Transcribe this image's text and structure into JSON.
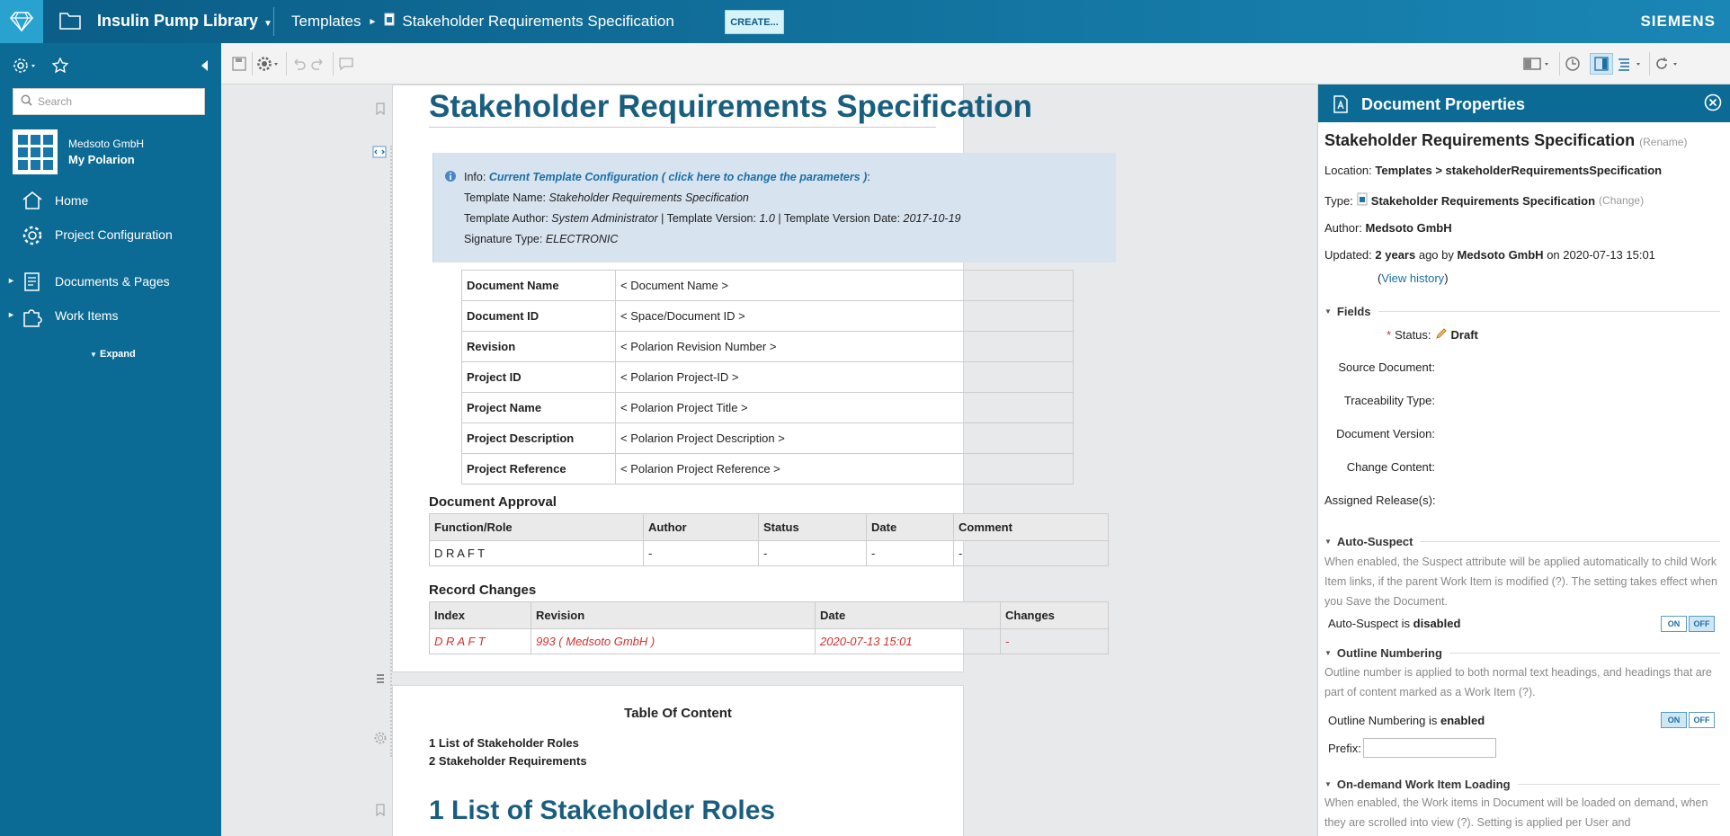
{
  "topbar": {
    "project": "Insulin Pump Library",
    "crumb_parent": "Templates",
    "crumb_doc": "Stakeholder Requirements Specification",
    "create_label": "CREATE...",
    "brand": "SIEMENS"
  },
  "sidebar": {
    "search_placeholder": "Search",
    "org": "Medsoto GmbH",
    "proj": "My Polarion",
    "home": "Home",
    "project_configuration": "Project Configuration",
    "documents_pages": "Documents & Pages",
    "work_items": "Work Items",
    "expand": "Expand"
  },
  "document": {
    "title": "Stakeholder Requirements Specification",
    "info": {
      "prefix": "Info:",
      "link": "Current Template Configuration ( click here to change the parameters )",
      "suffix": ":",
      "name_label": "Template Name:",
      "name_value": "Stakeholder Requirements Specification",
      "author_label": "Template Author:",
      "author_value": "System Administrator",
      "version_label": "| Template Version:",
      "version_value": "1.0",
      "date_label": "| Template Version Date:",
      "date_value": "2017-10-19",
      "sig_label": "Signature Type:",
      "sig_value": "ELECTRONIC"
    },
    "meta": [
      {
        "k": "Document Name",
        "v": "< Document Name >"
      },
      {
        "k": "Document ID",
        "v": "< Space/Document ID >"
      },
      {
        "k": "Revision",
        "v": "< Polarion Revision Number >"
      },
      {
        "k": "Project ID",
        "v": "< Polarion Project-ID >"
      },
      {
        "k": "Project Name",
        "v": "< Polarion Project Title >"
      },
      {
        "k": "Project Description",
        "v": "< Polarion Project Description >"
      },
      {
        "k": "Project Reference",
        "v": "< Polarion Project Reference >"
      }
    ],
    "approval": {
      "heading": "Document Approval",
      "headers": [
        "Function/Role",
        "Author",
        "Status",
        "Date",
        "Comment"
      ],
      "row": [
        "D R A F T",
        "-",
        "-",
        "-",
        "-"
      ]
    },
    "changes": {
      "heading": "Record Changes",
      "headers": [
        "Index",
        "Revision",
        "Date",
        "Changes"
      ],
      "row": [
        "D R A F T",
        "993  ( Medsoto GmbH )",
        "2020-07-13 15:01",
        "-"
      ]
    },
    "toc": {
      "heading": "Table Of Content",
      "items": [
        "1 List of Stakeholder Roles",
        "2 Stakeholder Requirements"
      ]
    },
    "h1": "1 List of Stakeholder Roles"
  },
  "props": {
    "header": "Document Properties",
    "title": "Stakeholder Requirements Specification",
    "rename": "(Rename)",
    "location_label": "Location:",
    "location_value": "Templates > stakeholderRequirementsSpecification",
    "type_label": "Type:",
    "type_value": "Stakeholder Requirements Specification",
    "type_change": "(Change)",
    "author_label": "Author:",
    "author_value": "Medsoto GmbH",
    "updated_label": "Updated:",
    "updated_ago": "2 years",
    "updated_mid": "ago by",
    "updated_by": "Medsoto GmbH",
    "updated_on": "on 2020-07-13 15:01",
    "view_history": "View history",
    "fields_heading": "Fields",
    "status_label": "Status:",
    "status_value": "Draft",
    "source_document": "Source Document:",
    "traceability_type": "Traceability Type:",
    "document_version": "Document Version:",
    "change_content": "Change Content:",
    "assigned_releases": "Assigned Release(s):",
    "auto_suspect_heading": "Auto-Suspect",
    "auto_suspect_desc": "When enabled, the Suspect attribute will be applied automatically to child Work Item links, if the parent Work Item is modified (?). The setting takes effect when you Save the Document.",
    "auto_suspect_state_prefix": "Auto-Suspect is",
    "auto_suspect_state": "disabled",
    "outline_heading": "Outline Numbering",
    "outline_desc": "Outline number is applied to both normal text headings, and headings that are part of content marked as a Work Item (?).",
    "outline_state_prefix": "Outline Numbering is",
    "outline_state": "enabled",
    "prefix_label": "Prefix:",
    "ondemand_heading": "On-demand Work Item Loading",
    "ondemand_desc": "When enabled, the Work items in Document will be loaded on demand, when they are scrolled into view (?). Setting is applied per User and",
    "on": "ON",
    "off": "OFF"
  }
}
